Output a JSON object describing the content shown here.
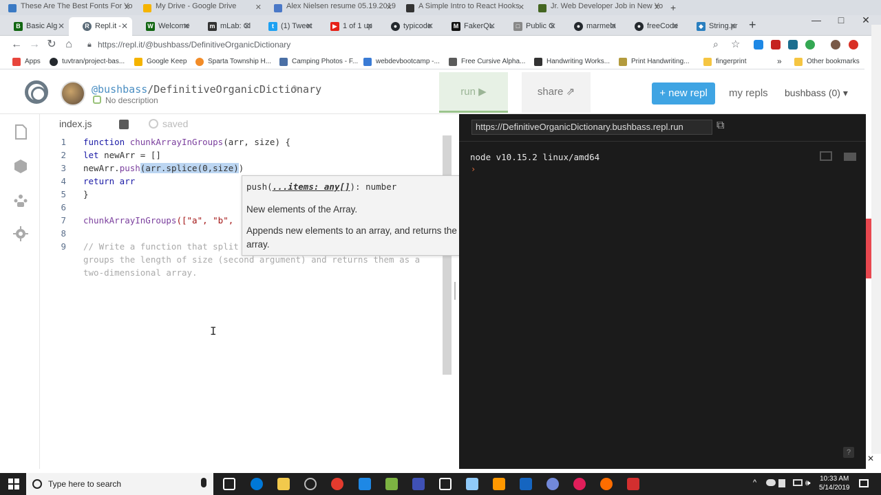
{
  "top_tabs": [
    {
      "title": "These Are The Best Fonts For Yo",
      "color": "#3b7ac4"
    },
    {
      "title": "My Drive - Google Drive",
      "color": "#f5b400"
    },
    {
      "title": "Alex Nielsen resume 05.19.2019",
      "color": "#4a78c7"
    },
    {
      "title": "A Simple Intro to React Hooks",
      "color": "#333333"
    },
    {
      "title": "Jr. Web Developer Job in New Yo",
      "color": "#446621"
    }
  ],
  "browser_tabs": [
    {
      "title": "Basic Alg",
      "icon": "B",
      "color": "#116611"
    },
    {
      "title": "Repl.it - ",
      "icon": "R",
      "color": "#5a6b78"
    },
    {
      "title": "Welcome",
      "icon": "W",
      "color": "#116611"
    },
    {
      "title": "mLab: Cl",
      "icon": "m",
      "color": "#333333"
    },
    {
      "title": "(1) Tweet",
      "icon": "t",
      "color": "#1da1f2"
    },
    {
      "title": "1 of 1 up",
      "icon": "▶",
      "color": "#e62117"
    },
    {
      "title": "typicode",
      "icon": "●",
      "color": "#24292e"
    },
    {
      "title": "FakerQL",
      "icon": "M",
      "color": "#111111"
    },
    {
      "title": "Public G",
      "icon": "□",
      "color": "#888888"
    },
    {
      "title": "marmela",
      "icon": "●",
      "color": "#24292e"
    },
    {
      "title": "freeCode",
      "icon": "●",
      "color": "#24292e"
    },
    {
      "title": "String.pr",
      "icon": "◆",
      "color": "#2a7fbf"
    }
  ],
  "window_controls": {
    "minimize": "—",
    "maximize": "□",
    "close": "✕"
  },
  "omnibox": {
    "url": "https://repl.it/@bushbass/DefinitiveOrganicDictionary"
  },
  "bookmarks": [
    {
      "label": "Apps",
      "color": "#e8453c"
    },
    {
      "label": "tuvtran/project-bas...",
      "color": "#24292e"
    },
    {
      "label": "Google Keep",
      "color": "#f5b400"
    },
    {
      "label": "Sparta Township H...",
      "color": "#f28c28"
    },
    {
      "label": "Camping Photos - F...",
      "color": "#4a6fa5"
    },
    {
      "label": "webdevbootcamp -...",
      "color": "#3a7bd5"
    },
    {
      "label": "Free Cursive Alpha...",
      "color": "#5b5b5b"
    },
    {
      "label": "Handwriting Works...",
      "color": "#333333"
    },
    {
      "label": "Print Handwriting...",
      "color": "#b39b3d"
    },
    {
      "label": "fingerprint",
      "color": "#f5c542"
    }
  ],
  "bookmarks_other": "Other bookmarks",
  "repl": {
    "user": "@bushbass",
    "name": "/DefinitiveOrganicDictionary",
    "description": "No description",
    "run_label": "run ▶",
    "share_label": "share",
    "new_repl_label": "+ new repl",
    "my_repls_label": "my repls",
    "user_menu_label": "bushbass (0) ▾"
  },
  "editor": {
    "file_name": "index.js",
    "status": "saved",
    "line_numbers": [
      "1",
      "2",
      "3",
      "4",
      "5",
      "6",
      "7",
      "8",
      "9"
    ],
    "code": {
      "l1_kw": "function ",
      "l1_fn": "chunkArrayInGroups",
      "l1_rest": "(arr, size) {",
      "l2_kw": "let ",
      "l2_rest": "newArr = []",
      "l3_pre": "newArr.",
      "l3_fn": "push",
      "l3_paren": "(",
      "l3_sel": "arr.splice(0,size)",
      "l3_post": ")",
      "l4": "return arr",
      "l5": "}",
      "l7_fn": "chunkArrayInGroups",
      "l7_rest": "([\"a\", \"b\",",
      "l9a": "// Write a function that split",
      "l9b": "groups the length of size (second argument) and returns them as a",
      "l9c": "two-dimensional array."
    }
  },
  "tooltip": {
    "sig_fn": "push(",
    "sig_param": "...items: any[]",
    "sig_ret": "): number",
    "desc1": "New elements of the Array.",
    "desc2": "Appends new elements to an array, and returns the new length of the array."
  },
  "console": {
    "url": "https://DefinitiveOrganicDictionary.bushbass.repl.run",
    "node_version": "node v10.15.2 linux/amd64",
    "prompt": "›"
  },
  "taskbar": {
    "search_placeholder": "Type here to search",
    "time": "10:33 AM",
    "date": "5/14/2019"
  }
}
